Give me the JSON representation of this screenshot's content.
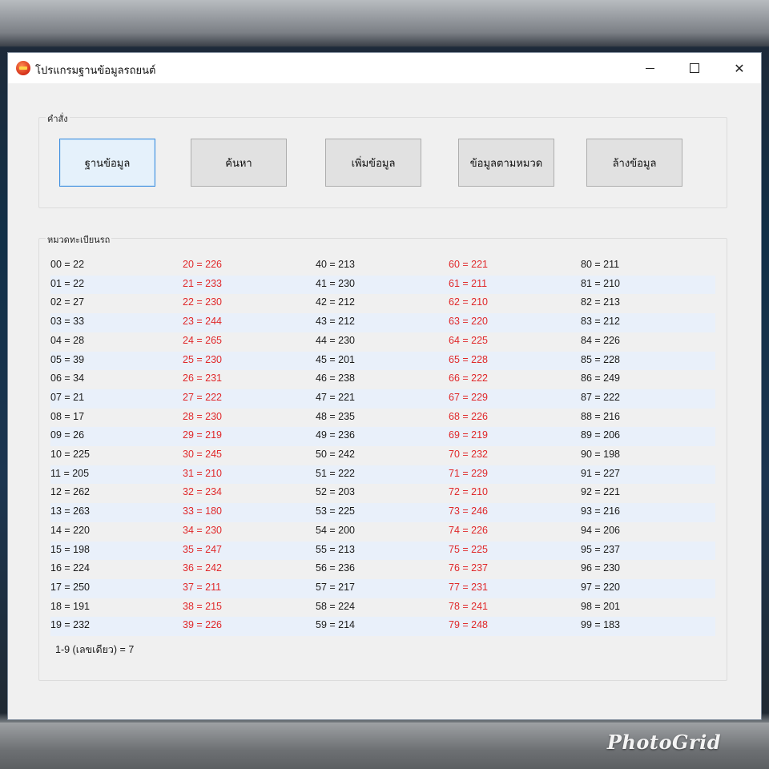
{
  "window": {
    "title": "โปรแกรมฐานข้อมูลรถยนต์",
    "controls": {
      "minimize": "minimize",
      "maximize": "maximize",
      "close": "✕"
    }
  },
  "commands": {
    "legend": "คำสั่ง",
    "buttons": [
      {
        "label": "ฐานข้อมูล",
        "active": true
      },
      {
        "label": "ค้นหา",
        "active": false
      },
      {
        "label": "เพิ่มข้อมูล",
        "active": false
      },
      {
        "label": "ข้อมูลตามหมวด",
        "active": false
      },
      {
        "label": "ล้างข้อมูล",
        "active": false
      }
    ]
  },
  "categories": {
    "legend": "หมวดทะเบียนรถ",
    "colors": {
      "normal": "#1a1a1a",
      "highlight": "#e0282a"
    },
    "columns": [
      [
        "00 = 22",
        "01 = 22",
        "02 = 27",
        "03 = 33",
        "04 = 28",
        "05 = 39",
        "06 = 34",
        "07 = 21",
        "08 = 17",
        "09 = 26",
        "10 = 225",
        "11 = 205",
        "12 = 262",
        "13 = 263",
        "14 = 220",
        "15 = 198",
        "16 = 224",
        "17 = 250",
        "18 = 191",
        "19 = 232"
      ],
      [
        "20 = 226",
        "21 = 233",
        "22 = 230",
        "23 = 244",
        "24 = 265",
        "25 = 230",
        "26 = 231",
        "27 = 222",
        "28 = 230",
        "29 = 219",
        "30 = 245",
        "31 = 210",
        "32 = 234",
        "33 = 180",
        "34 = 230",
        "35 = 247",
        "36 = 242",
        "37 = 211",
        "38 = 215",
        "39 = 226"
      ],
      [
        "40 = 213",
        "41 = 230",
        "42 = 212",
        "43 = 212",
        "44 = 230",
        "45 = 201",
        "46 = 238",
        "47 = 221",
        "48 = 235",
        "49 = 236",
        "50 = 242",
        "51 = 222",
        "52 = 203",
        "53 = 225",
        "54 = 200",
        "55 = 213",
        "56 = 236",
        "57 = 217",
        "58 = 224",
        "59 = 214"
      ],
      [
        "60 = 221",
        "61 = 211",
        "62 = 210",
        "63 = 220",
        "64 = 225",
        "65 = 228",
        "66 = 222",
        "67 = 229",
        "68 = 226",
        "69 = 219",
        "70 = 232",
        "71 = 229",
        "72 = 210",
        "73 = 246",
        "74 = 226",
        "75 = 225",
        "76 = 237",
        "77 = 231",
        "78 = 241",
        "79 = 248"
      ],
      [
        "80 = 211",
        "81 = 210",
        "82 = 213",
        "83 = 212",
        "84 = 226",
        "85 = 228",
        "86 = 249",
        "87 = 222",
        "88 = 216",
        "89 = 206",
        "90 = 198",
        "91 = 227",
        "92 = 221",
        "93 = 216",
        "94 = 206",
        "95 = 237",
        "96 = 230",
        "97 = 220",
        "98 = 201",
        "99 = 183"
      ]
    ],
    "column_highlight": [
      false,
      true,
      false,
      true,
      false
    ],
    "footer": "1-9 (เลขเดียว) = 7"
  },
  "watermark": "PhotoGrid"
}
